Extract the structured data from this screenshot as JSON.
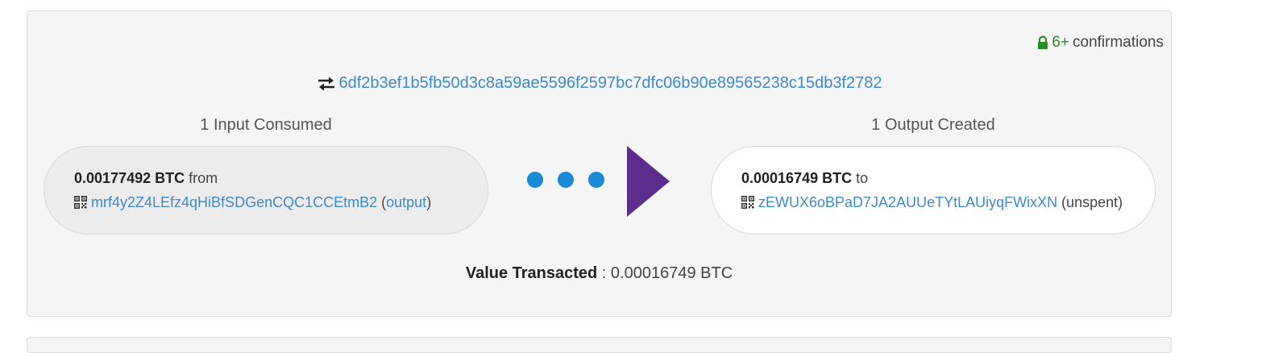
{
  "confirmations": {
    "count": "6+",
    "label": "confirmations",
    "icon": "lock-icon",
    "color": "#2a8a2a"
  },
  "transaction": {
    "txid": "6df2b3ef1b5fb50d3c8a59ae5596f2597bc7dfc06b90e89565238c15db3f2782",
    "icon": "swap-arrows-icon"
  },
  "inputs": {
    "title": "1 Input Consumed",
    "items": [
      {
        "amount": "0.00177492 BTC",
        "direction": "from",
        "address": "mrf4y2Z4LEfz4qHiBfSDGenCQC1CCEtmB2",
        "ref_open": "(",
        "ref_link": "output",
        "ref_close": ")"
      }
    ]
  },
  "outputs": {
    "title": "1 Output Created",
    "items": [
      {
        "amount": "0.00016749 BTC",
        "direction": "to",
        "address": "zEWUX6oBPaD7JA2AUUeTYtLAUiyqFWixXN",
        "status": "(unspent)"
      }
    ]
  },
  "value": {
    "label": "Value Transacted",
    "separator": " : ",
    "amount": "0.00016749 BTC"
  },
  "colors": {
    "link": "#3d8ac7",
    "dots": "#1a8ad6",
    "arrow": "#5b2d8c"
  }
}
